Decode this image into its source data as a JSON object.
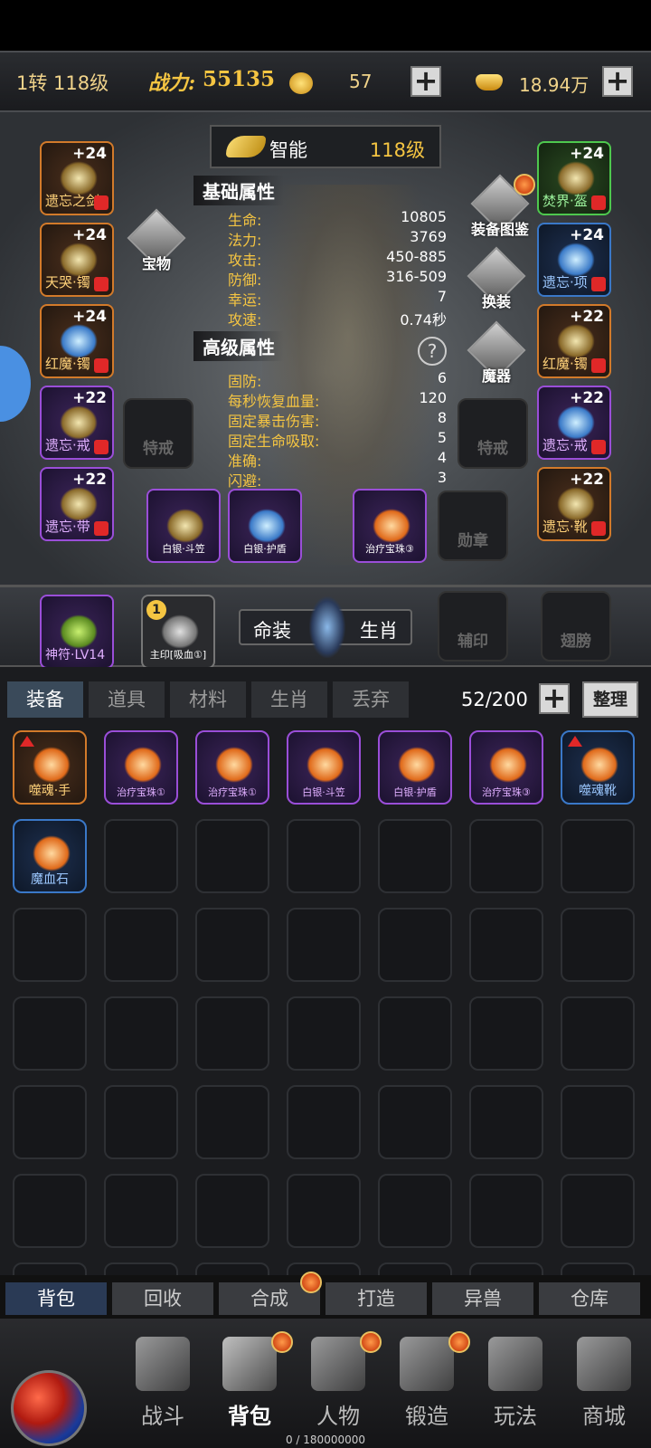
{
  "topbar": {
    "level": "1转 118级",
    "power_label": "战力:",
    "power": "55135",
    "coin": "57",
    "ingot": "18.94万"
  },
  "character": {
    "class": "智能",
    "level": "118级",
    "basic_title": "基础属性",
    "basic_stats": [
      {
        "k": "生命:",
        "v": "10805"
      },
      {
        "k": "法力:",
        "v": "3769"
      },
      {
        "k": "攻击:",
        "v": "450-885"
      },
      {
        "k": "防御:",
        "v": "316-509"
      },
      {
        "k": "幸运:",
        "v": "7"
      },
      {
        "k": "攻速:",
        "v": "0.74秒"
      }
    ],
    "adv_title": "高级属性",
    "adv_stats": [
      {
        "k": "固防:",
        "v": "6"
      },
      {
        "k": "每秒恢复血量:",
        "v": "120"
      },
      {
        "k": "固定暴击伤害:",
        "v": "8"
      },
      {
        "k": "固定生命吸取:",
        "v": "5"
      },
      {
        "k": "准确:",
        "v": "4"
      },
      {
        "k": "闪避:",
        "v": "3"
      }
    ]
  },
  "left_slots": [
    {
      "plus": "+24",
      "label": "遗忘之剑"
    },
    {
      "plus": "+24",
      "label": "天哭·镯"
    },
    {
      "plus": "+24",
      "label": "红魔·镯"
    },
    {
      "plus": "+22",
      "label": "遗忘·戒"
    },
    {
      "plus": "+22",
      "label": "遗忘·带"
    }
  ],
  "right_slots": [
    {
      "plus": "+24",
      "label": "焚界·盔"
    },
    {
      "plus": "+24",
      "label": "遗忘·项"
    },
    {
      "plus": "+22",
      "label": "红魔·镯"
    },
    {
      "plus": "+22",
      "label": "遗忘·戒"
    },
    {
      "plus": "+22",
      "label": "遗忘·靴"
    }
  ],
  "emblems": {
    "treasure": "宝物",
    "catalog": "装备图鉴",
    "swap": "换装",
    "magic": "魔器",
    "special_ring_left": "特戒",
    "special_ring_right": "特戒",
    "medal": "勋章"
  },
  "bottom_equip": [
    {
      "label": "白银·斗笠"
    },
    {
      "label": "白银·护盾"
    },
    {
      "label": "治疗宝珠③"
    }
  ],
  "runebar": {
    "rune": "神符·LV14",
    "seal_num": "1",
    "seal": "主印[吸血①]",
    "tab_a": "命装",
    "tab_b": "生肖",
    "aux_seal": "辅印",
    "wings": "翅膀"
  },
  "inventory": {
    "tabs": [
      "装备",
      "道具",
      "材料",
      "生肖",
      "丢弃"
    ],
    "count": "52/200",
    "sort": "整理",
    "items": [
      {
        "label": "噬魂·手",
        "tier": "orange",
        "up": true
      },
      {
        "label": "治疗宝珠①",
        "tier": "purple",
        "up": false
      },
      {
        "label": "治疗宝珠①",
        "tier": "purple",
        "up": false
      },
      {
        "label": "白银·斗笠",
        "tier": "purple",
        "up": false
      },
      {
        "label": "白银·护盾",
        "tier": "purple",
        "up": false
      },
      {
        "label": "治疗宝珠③",
        "tier": "purple",
        "up": false
      },
      {
        "label": "噬魂靴",
        "tier": "blue",
        "up": true
      },
      {
        "label": "魔血石",
        "tier": "blue",
        "up": false
      }
    ]
  },
  "subtabs": [
    "背包",
    "回收",
    "合成",
    "打造",
    "异兽",
    "仓库"
  ],
  "nav": [
    "战斗",
    "背包",
    "人物",
    "锻造",
    "玩法",
    "商城"
  ],
  "exp": "0 / 180000000"
}
